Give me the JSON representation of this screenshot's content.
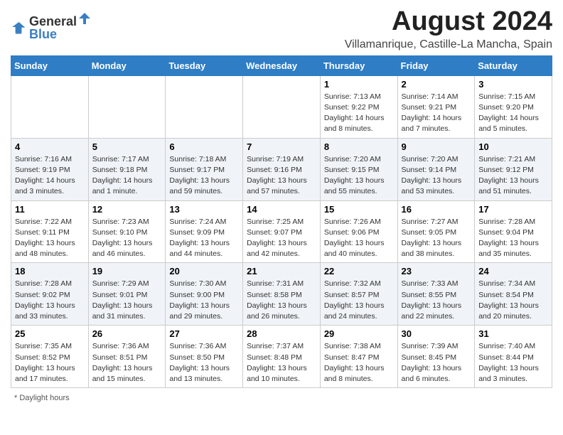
{
  "header": {
    "logo_general": "General",
    "logo_blue": "Blue",
    "main_title": "August 2024",
    "subtitle": "Villamanrique, Castille-La Mancha, Spain"
  },
  "days_of_week": [
    "Sunday",
    "Monday",
    "Tuesday",
    "Wednesday",
    "Thursday",
    "Friday",
    "Saturday"
  ],
  "weeks": [
    [
      {
        "day": "",
        "info": ""
      },
      {
        "day": "",
        "info": ""
      },
      {
        "day": "",
        "info": ""
      },
      {
        "day": "",
        "info": ""
      },
      {
        "day": "1",
        "info": "Sunrise: 7:13 AM\nSunset: 9:22 PM\nDaylight: 14 hours and 8 minutes."
      },
      {
        "day": "2",
        "info": "Sunrise: 7:14 AM\nSunset: 9:21 PM\nDaylight: 14 hours and 7 minutes."
      },
      {
        "day": "3",
        "info": "Sunrise: 7:15 AM\nSunset: 9:20 PM\nDaylight: 14 hours and 5 minutes."
      }
    ],
    [
      {
        "day": "4",
        "info": "Sunrise: 7:16 AM\nSunset: 9:19 PM\nDaylight: 14 hours and 3 minutes."
      },
      {
        "day": "5",
        "info": "Sunrise: 7:17 AM\nSunset: 9:18 PM\nDaylight: 14 hours and 1 minute."
      },
      {
        "day": "6",
        "info": "Sunrise: 7:18 AM\nSunset: 9:17 PM\nDaylight: 13 hours and 59 minutes."
      },
      {
        "day": "7",
        "info": "Sunrise: 7:19 AM\nSunset: 9:16 PM\nDaylight: 13 hours and 57 minutes."
      },
      {
        "day": "8",
        "info": "Sunrise: 7:20 AM\nSunset: 9:15 PM\nDaylight: 13 hours and 55 minutes."
      },
      {
        "day": "9",
        "info": "Sunrise: 7:20 AM\nSunset: 9:14 PM\nDaylight: 13 hours and 53 minutes."
      },
      {
        "day": "10",
        "info": "Sunrise: 7:21 AM\nSunset: 9:12 PM\nDaylight: 13 hours and 51 minutes."
      }
    ],
    [
      {
        "day": "11",
        "info": "Sunrise: 7:22 AM\nSunset: 9:11 PM\nDaylight: 13 hours and 48 minutes."
      },
      {
        "day": "12",
        "info": "Sunrise: 7:23 AM\nSunset: 9:10 PM\nDaylight: 13 hours and 46 minutes."
      },
      {
        "day": "13",
        "info": "Sunrise: 7:24 AM\nSunset: 9:09 PM\nDaylight: 13 hours and 44 minutes."
      },
      {
        "day": "14",
        "info": "Sunrise: 7:25 AM\nSunset: 9:07 PM\nDaylight: 13 hours and 42 minutes."
      },
      {
        "day": "15",
        "info": "Sunrise: 7:26 AM\nSunset: 9:06 PM\nDaylight: 13 hours and 40 minutes."
      },
      {
        "day": "16",
        "info": "Sunrise: 7:27 AM\nSunset: 9:05 PM\nDaylight: 13 hours and 38 minutes."
      },
      {
        "day": "17",
        "info": "Sunrise: 7:28 AM\nSunset: 9:04 PM\nDaylight: 13 hours and 35 minutes."
      }
    ],
    [
      {
        "day": "18",
        "info": "Sunrise: 7:28 AM\nSunset: 9:02 PM\nDaylight: 13 hours and 33 minutes."
      },
      {
        "day": "19",
        "info": "Sunrise: 7:29 AM\nSunset: 9:01 PM\nDaylight: 13 hours and 31 minutes."
      },
      {
        "day": "20",
        "info": "Sunrise: 7:30 AM\nSunset: 9:00 PM\nDaylight: 13 hours and 29 minutes."
      },
      {
        "day": "21",
        "info": "Sunrise: 7:31 AM\nSunset: 8:58 PM\nDaylight: 13 hours and 26 minutes."
      },
      {
        "day": "22",
        "info": "Sunrise: 7:32 AM\nSunset: 8:57 PM\nDaylight: 13 hours and 24 minutes."
      },
      {
        "day": "23",
        "info": "Sunrise: 7:33 AM\nSunset: 8:55 PM\nDaylight: 13 hours and 22 minutes."
      },
      {
        "day": "24",
        "info": "Sunrise: 7:34 AM\nSunset: 8:54 PM\nDaylight: 13 hours and 20 minutes."
      }
    ],
    [
      {
        "day": "25",
        "info": "Sunrise: 7:35 AM\nSunset: 8:52 PM\nDaylight: 13 hours and 17 minutes."
      },
      {
        "day": "26",
        "info": "Sunrise: 7:36 AM\nSunset: 8:51 PM\nDaylight: 13 hours and 15 minutes."
      },
      {
        "day": "27",
        "info": "Sunrise: 7:36 AM\nSunset: 8:50 PM\nDaylight: 13 hours and 13 minutes."
      },
      {
        "day": "28",
        "info": "Sunrise: 7:37 AM\nSunset: 8:48 PM\nDaylight: 13 hours and 10 minutes."
      },
      {
        "day": "29",
        "info": "Sunrise: 7:38 AM\nSunset: 8:47 PM\nDaylight: 13 hours and 8 minutes."
      },
      {
        "day": "30",
        "info": "Sunrise: 7:39 AM\nSunset: 8:45 PM\nDaylight: 13 hours and 6 minutes."
      },
      {
        "day": "31",
        "info": "Sunrise: 7:40 AM\nSunset: 8:44 PM\nDaylight: 13 hours and 3 minutes."
      }
    ]
  ],
  "footer": {
    "daylight_label": "Daylight hours"
  }
}
